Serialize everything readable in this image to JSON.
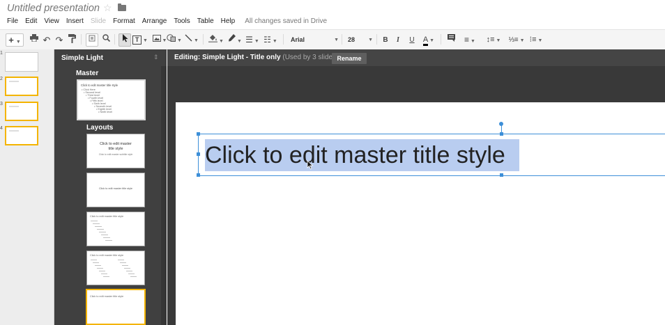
{
  "app": {
    "doc_title": "Untitled presentation",
    "save_status": "All changes saved in Drive"
  },
  "menu": [
    {
      "label": "File",
      "enabled": true
    },
    {
      "label": "Edit",
      "enabled": true
    },
    {
      "label": "View",
      "enabled": true
    },
    {
      "label": "Insert",
      "enabled": true
    },
    {
      "label": "Slide",
      "enabled": false
    },
    {
      "label": "Format",
      "enabled": true
    },
    {
      "label": "Arrange",
      "enabled": true
    },
    {
      "label": "Tools",
      "enabled": true
    },
    {
      "label": "Table",
      "enabled": true
    },
    {
      "label": "Help",
      "enabled": true
    }
  ],
  "toolbar": {
    "font_name": "Arial",
    "font_size": "28",
    "bold": "B",
    "italic": "I",
    "underline": "U",
    "text_color": "A",
    "text_color_hex": "#000000",
    "icons": [
      "plus-icon",
      "print-icon",
      "undo-icon",
      "redo-icon",
      "paint-format-icon",
      "zoom-fit-icon",
      "zoom-icon",
      "select-icon",
      "text-box-icon",
      "image-icon",
      "shape-icon",
      "line-icon",
      "fill-color-icon",
      "line-color-icon",
      "line-weight-icon",
      "line-dash-icon",
      "bold-icon",
      "italic-icon",
      "underline-icon",
      "text-color-icon",
      "comment-icon",
      "align-icon",
      "line-spacing-icon",
      "numbered-list-icon",
      "bulleted-list-icon"
    ]
  },
  "filmstrip": {
    "slides": [
      {
        "number": "1",
        "selected": false
      },
      {
        "number": "2",
        "selected": true
      },
      {
        "number": "3",
        "selected": true
      },
      {
        "number": "4",
        "selected": true
      }
    ]
  },
  "master_panel": {
    "theme_name": "Simple Light",
    "master_label": "Master",
    "layouts_label": "Layouts",
    "master_thumb_lines": [
      "Click to edit master title style",
      "• Click Here",
      "• Second level",
      "• Third level",
      "• Fourth level",
      "• Fifth level",
      "• Sixth level",
      "• Seventh level",
      "• Eighth level",
      "• Ninth level"
    ],
    "layouts": [
      {
        "title": "Click to edit master title style",
        "subtitle": "Click to edit master subtitle style",
        "selected": false
      },
      {
        "title": "Click to edit master title style",
        "selected": false
      },
      {
        "title": "Click to edit master title style",
        "selected": false
      },
      {
        "title": "Click to edit master title style",
        "selected": false
      },
      {
        "title": "Click to edit master title style",
        "selected": true
      }
    ]
  },
  "editor": {
    "editing_label": "Editing: Simple Light - Title only",
    "editing_sub": "(Used by 3 slides)",
    "rename_label": "Rename",
    "title_text": "Click to edit master title style",
    "accent_color": "#3d8fd8",
    "selection_color": "#b9cdf0",
    "thumbnail_selected_color": "#f4b400"
  }
}
